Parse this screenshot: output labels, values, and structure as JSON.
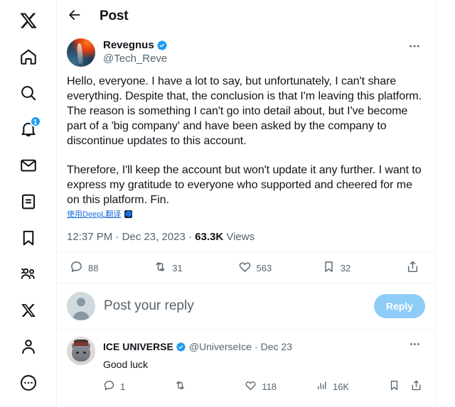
{
  "sidebar": {
    "items": [
      {
        "name": "x-logo-icon",
        "label": "X"
      },
      {
        "name": "home-icon",
        "label": "Home"
      },
      {
        "name": "search-icon",
        "label": "Explore"
      },
      {
        "name": "notifications-icon",
        "label": "Notifications",
        "badge": "1"
      },
      {
        "name": "messages-icon",
        "label": "Messages"
      },
      {
        "name": "grok-icon",
        "label": "Grok"
      },
      {
        "name": "bookmarks-icon",
        "label": "Bookmarks"
      },
      {
        "name": "communities-icon",
        "label": "Communities"
      },
      {
        "name": "premium-icon",
        "label": "Premium"
      },
      {
        "name": "profile-icon",
        "label": "Profile"
      },
      {
        "name": "more-icon",
        "label": "More"
      }
    ]
  },
  "header": {
    "back_label": "Back",
    "title": "Post"
  },
  "post": {
    "display_name": "Revegnus",
    "handle": "@Tech_Reve",
    "verified": true,
    "more_label": "More",
    "paragraphs": [
      "Hello, everyone. I have a lot to say, but unfortunately, I can't share everything. Despite that, the conclusion is that I'm leaving this platform. The reason is something I can't go into detail about, but I've become part of a 'big company' and have been asked by the company to discontinue updates to this account.",
      "Therefore, I'll keep the account but won't update it any further. I want to express my gratitude to everyone who supported and cheered for me on this platform. Fin."
    ],
    "translate_label": "使用DeepL翻译",
    "time": "12:37 PM",
    "date": "Dec 23, 2023",
    "views_count": "63.3K",
    "views_label": "Views",
    "meta_separator": " · ",
    "actions": {
      "replies": "88",
      "reposts": "31",
      "likes": "563",
      "bookmarks": "32",
      "share_label": "Share"
    }
  },
  "composer": {
    "placeholder": "Post your reply",
    "value": "",
    "button_label": "Reply"
  },
  "replies": [
    {
      "display_name": "ICE UNIVERSE",
      "handle": "@UniverseIce",
      "verified": true,
      "separator": " · ",
      "date": "Dec 23",
      "text": "Good luck",
      "more_label": "More",
      "actions": {
        "replies": "1",
        "reposts": "",
        "likes": "118",
        "views": "16K",
        "bookmark_label": "Bookmark",
        "share_label": "Share"
      }
    }
  ],
  "colors": {
    "accent": "#1d9bf0",
    "verified_blue": "#1d9bf0",
    "text_primary": "#0f1419",
    "text_secondary": "#536471",
    "border": "#eff3f4",
    "reply_button": "#8ecdf8",
    "link_blue": "#1d6fdf"
  }
}
